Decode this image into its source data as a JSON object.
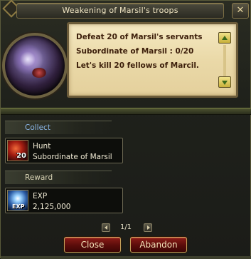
{
  "window": {
    "title": "Weakening of Marsil's troops",
    "close_symbol": "✕"
  },
  "quest": {
    "lines": [
      "Defeat 20 of Marsil's servants",
      "Subordinate of Marsil : 0/20",
      "Let's kill 20 fellows of Marcil."
    ]
  },
  "collect": {
    "header": "Collect",
    "item": {
      "icon": "hunt-icon",
      "count": "20",
      "title": "Hunt",
      "target": "Subordinate of Marsil"
    }
  },
  "reward": {
    "header": "Reward",
    "item": {
      "icon": "exp-icon",
      "tag": "EXP",
      "title": "EXP",
      "amount": "2,125,000"
    }
  },
  "pager": {
    "text": "1/1"
  },
  "buttons": {
    "close_label": "Close",
    "abandon_label": "Abandon"
  },
  "colors": {
    "accent_red": "#8b1c17",
    "parchment": "#f5e9c2",
    "quest_text": "#3c1e0a",
    "collect_header": "#8ab6e8"
  }
}
